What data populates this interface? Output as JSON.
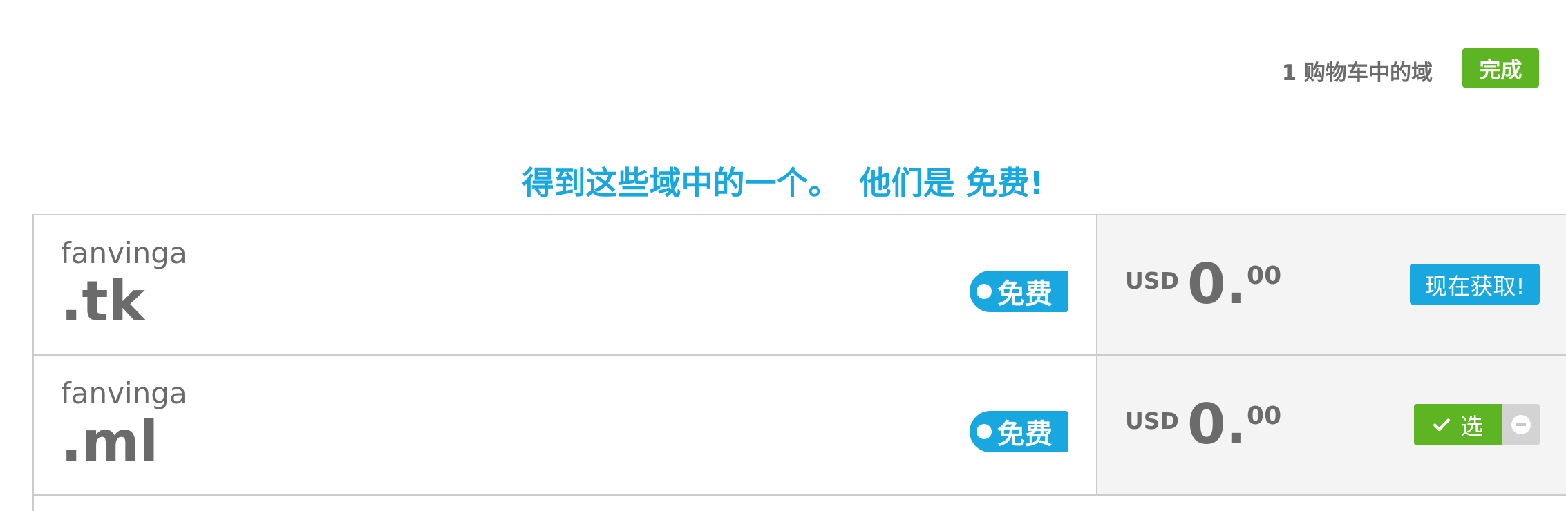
{
  "cart": {
    "count_text": "1 购物车中的域",
    "done_label": "完成"
  },
  "headline": {
    "part1": "得到这些域中的一个。",
    "part2": "他们是 免费!"
  },
  "domains": [
    {
      "name": "fanvinga",
      "tld": ".tk",
      "tag": "免费",
      "currency": "USD",
      "price_whole": "0.",
      "price_cents": "00",
      "action_label": "现在获取!"
    },
    {
      "name": "fanvinga",
      "tld": ".ml",
      "tag": "免费",
      "currency": "USD",
      "price_whole": "0.",
      "price_cents": "00",
      "action_label": "选",
      "selected": true
    }
  ],
  "colors": {
    "accent_blue": "#19a7e0",
    "accent_green": "#5eb524",
    "text_gray": "#6b6b6b",
    "panel_gray": "#f4f4f4"
  },
  "icons": {
    "check": "check-icon",
    "remove": "minus-circle-icon",
    "tag_dot": "tag-hole-icon"
  }
}
